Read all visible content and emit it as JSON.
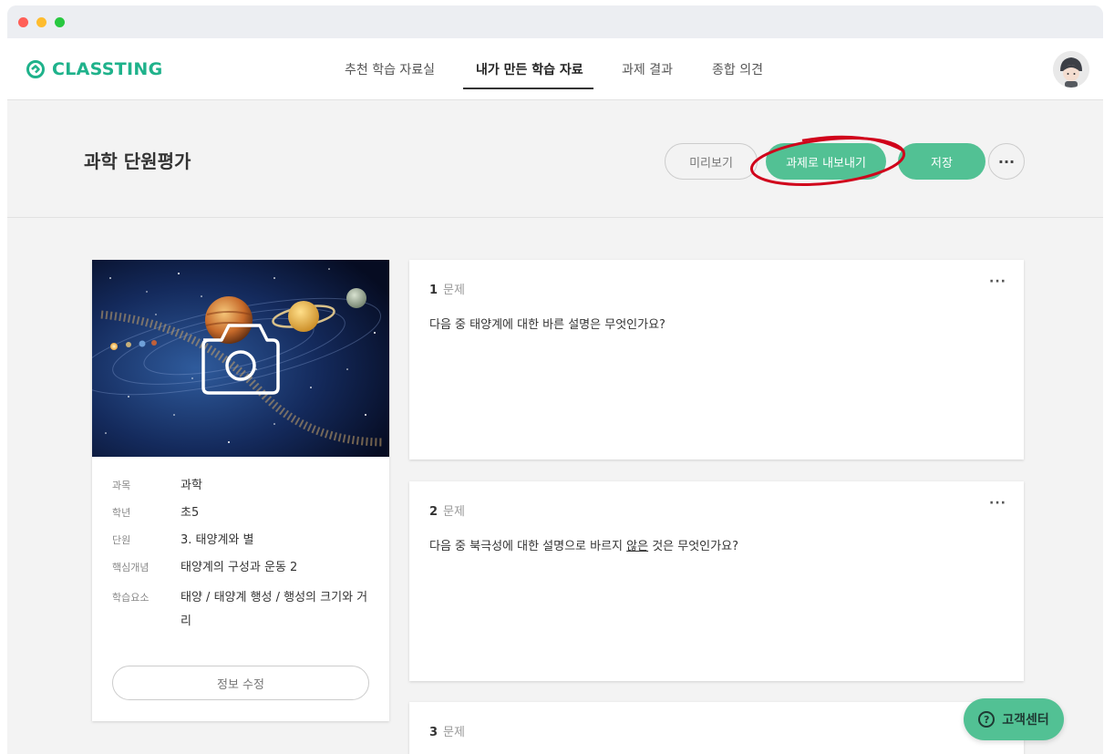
{
  "app": {
    "logo_text": "CLASSTING",
    "brand_color": "#1fb28b",
    "accent_color": "#52c194",
    "annotation_color": "#d0021b"
  },
  "nav": {
    "items": [
      {
        "label": "추천 학습 자료실",
        "active": false
      },
      {
        "label": "내가 만든 학습 자료",
        "active": true
      },
      {
        "label": "과제 결과",
        "active": false
      },
      {
        "label": "종합 의견",
        "active": false
      }
    ]
  },
  "header": {
    "title": "과학 단원평가",
    "preview_label": "미리보기",
    "export_label": "과제로 내보내기",
    "save_label": "저장",
    "more_label": "···"
  },
  "info": {
    "rows": [
      {
        "label": "과목",
        "value": "과학"
      },
      {
        "label": "학년",
        "value": "초5"
      },
      {
        "label": "단원",
        "value": "3. 태양계와 별"
      },
      {
        "label": "핵심개념",
        "value": "태양계의 구성과 운동 2"
      },
      {
        "label": "학습요소",
        "value": "태양 / 태양계 행성 / 행성의 크기와 거리"
      }
    ],
    "edit_label": "정보 수정"
  },
  "questions": [
    {
      "number": "1",
      "label": "문제",
      "text": "다음 중 태양계에 대한 바른 설명은 무엇인가요?"
    },
    {
      "number": "2",
      "label": "문제",
      "text_before": "다음 중 북극성에 대한 설명으로 바르지 ",
      "text_underlined": "않은",
      "text_after": " 것은 무엇인가요?"
    },
    {
      "number": "3",
      "label": "문제"
    }
  ],
  "help": {
    "icon_glyph": "?",
    "label": "고객센터"
  }
}
